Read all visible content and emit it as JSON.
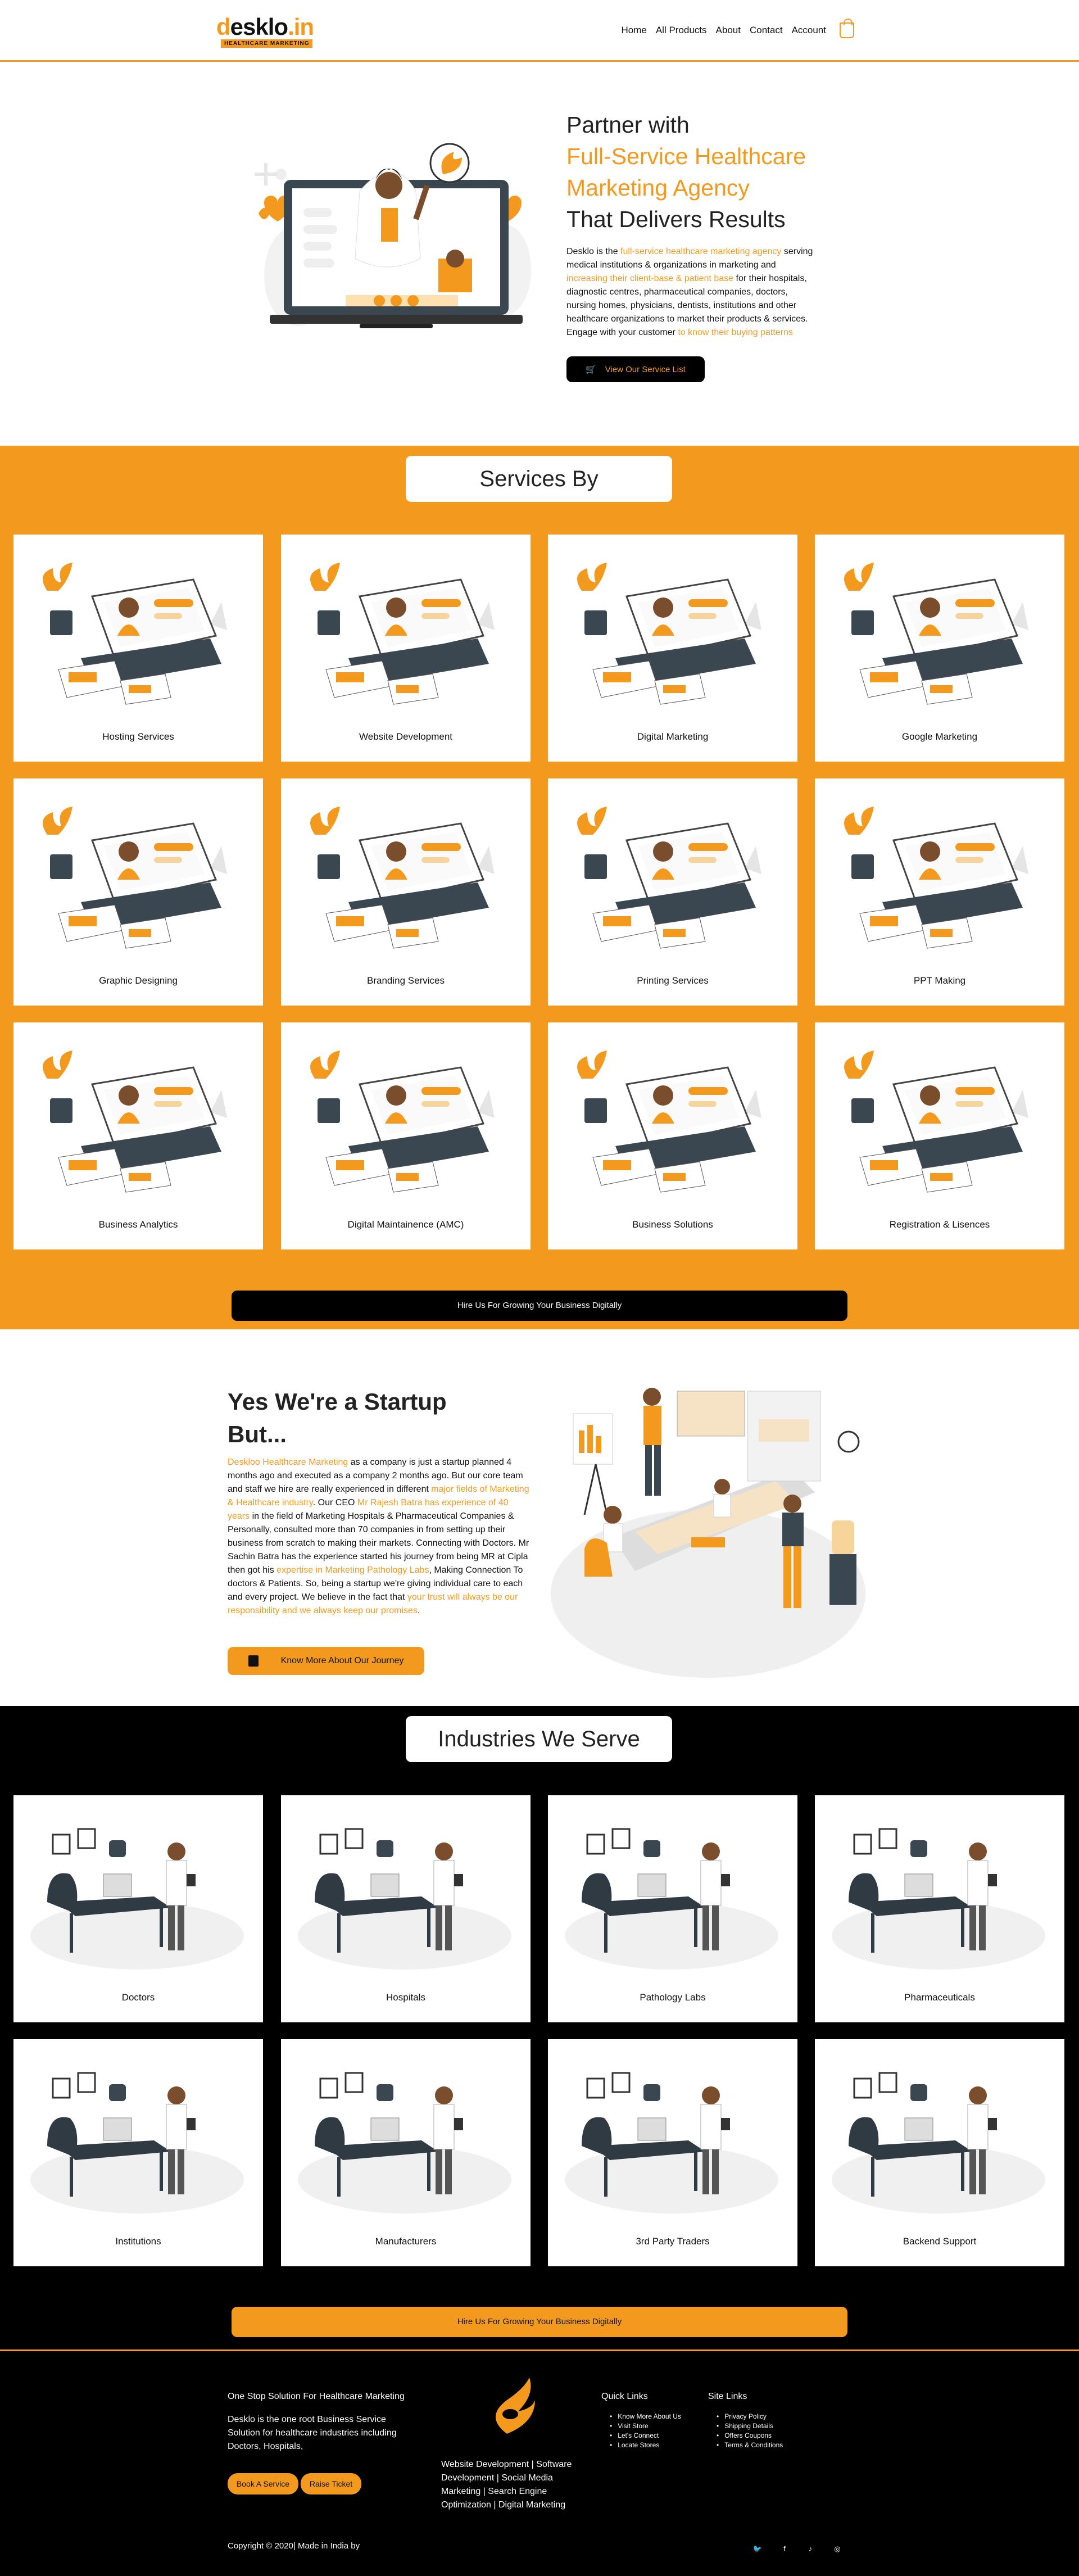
{
  "brand": {
    "name": "deskloin",
    "name_main": "esklo",
    "name_dot": ".in",
    "tagline": "HEALTHCARE MARKETING",
    "accent": "#f39a1e",
    "dark": "#000000"
  },
  "nav": {
    "items": [
      "Home",
      "All Products",
      "About",
      "Contact",
      "Account"
    ],
    "cart_icon": "shopping-bag-icon"
  },
  "hero": {
    "title_line1": "Partner with",
    "title_highlight": "Full-Service Healthcare Marketing Agency",
    "title_line3": "That Delivers Results",
    "desc_1": "Desklo is the ",
    "desc_h1": "full-service healthcare marketing agency",
    "desc_2": " serving medical institutions & organizations in marketing and ",
    "desc_h2": "increasing their client-base & patient base",
    "desc_3": " for their hospitals, diagnostic centres, pharmaceutical companies, doctors, nursing homes, physicians, dentists, institutions and other healthcare organizations to market their products & services. Engage with your customer ",
    "desc_h3": "to know their buying patterns",
    "button": "View Our Service List"
  },
  "services": {
    "title": "Services By",
    "items": [
      "Hosting Services",
      "Website Development",
      "Digital Marketing",
      "Google Marketing",
      "Graphic Designing",
      "Branding Services",
      "Printing Services",
      "PPT Making",
      "Business Analytics",
      "Digital Maintainence (AMC)",
      "Business Solutions",
      "Registration & Lisences"
    ],
    "cta": "Hire Us For Growing Your Business Digitally"
  },
  "startup": {
    "title": "Yes We're a Startup But...",
    "p1h": "Deskloo Healthcare Marketing",
    "p1": " as a company is just a startup planned 4 months ago and executed as a company 2 months ago. But our core team and staff we hire are really experienced in different ",
    "p2h": "major fields of Marketing & Healthcare industry",
    "p2": ". Our CEO ",
    "p3h": "Mr Rajesh Batra has experience of 40 years",
    "p3": " in the field of Marketing Hospitals & Pharmaceutical Companies & Personally, consulted more than 70 companies in from setting up their business from scratch to making their markets. Connecting with Doctors. Mr Sachin Batra has the experience started his journey from being MR at Cipla then got his ",
    "p4h": "expertise in Marketing Pathology Labs",
    "p4": ", Making Connection To doctors & Patients. So, being a startup we're giving individual care to each and every project. We believe in the fact that ",
    "p5h": "your trust will always be our responsibility and we always keep our promises",
    "p5": ".",
    "button": "Know More About Our Journey"
  },
  "industries": {
    "title": "Industries We Serve",
    "items": [
      "Doctors",
      "Hospitals",
      "Pathology Labs",
      "Pharmaceuticals",
      "Institutions",
      "Manufacturers",
      "3rd Party Traders",
      "Backend Support"
    ],
    "cta": "Hire Us For Growing Your Business Digitally"
  },
  "footer": {
    "about_title": "One Stop Solution For Healthcare Marketing",
    "about_text": "Desklo is the one root Business Service Solution for healthcare industries including Doctors, Hospitals,",
    "book_btn": "Book A Service",
    "ticket_btn": "Raise Ticket",
    "services_text": "Website Development | Software Development | Social Media Marketing | Search Engine Optimization | Digital Marketing",
    "quick_title": "Quick Links",
    "quick_links": [
      "Know More About Us",
      "Visit Store",
      "Let's Connect",
      "Locate Stores"
    ],
    "site_title": "Site Links",
    "site_links": [
      "Privacy Policy",
      "Shipping Details",
      "Offers Coupons",
      "Terms & Conditions"
    ],
    "copyright": "Copyright © 2020| Made in India by",
    "social": [
      "twitter-icon",
      "facebook-icon",
      "tiktok-icon",
      "instagram-icon"
    ]
  }
}
